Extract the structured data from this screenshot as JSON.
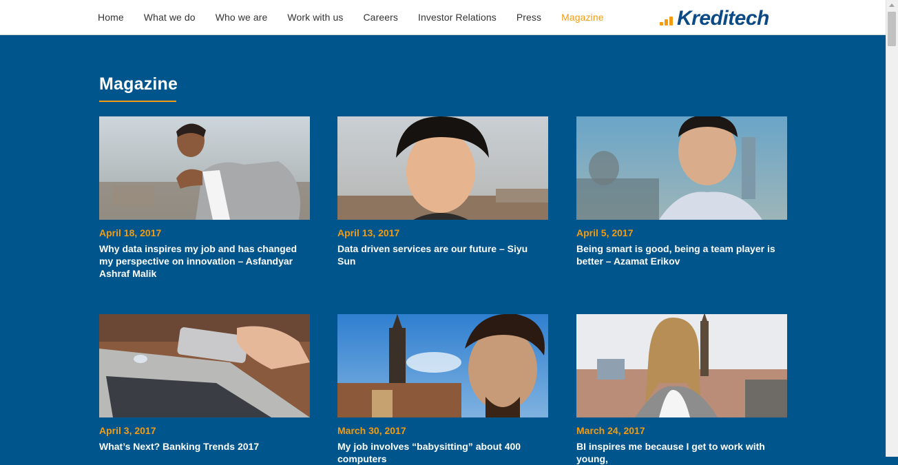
{
  "nav": {
    "items": [
      {
        "label": "Home"
      },
      {
        "label": "What we do"
      },
      {
        "label": "Who we are"
      },
      {
        "label": "Work with us"
      },
      {
        "label": "Careers"
      },
      {
        "label": "Investor Relations"
      },
      {
        "label": "Press"
      },
      {
        "label": "Magazine",
        "active": true
      }
    ],
    "logo_text": "Kreditech"
  },
  "main": {
    "title": "Magazine",
    "articles": [
      {
        "date": "April 18, 2017",
        "title": "Why data inspires my job and has changed my perspective on innovation – Asfandyar Ashraf Malik"
      },
      {
        "date": "April 13, 2017",
        "title": "Data driven services are our future – Siyu Sun"
      },
      {
        "date": "April 5, 2017",
        "title": "Being smart is good, being a team player is better – Azamat Erikov"
      },
      {
        "date": "April 3, 2017",
        "title": "What’s Next? Banking Trends 2017"
      },
      {
        "date": "March 30, 2017",
        "title": "My job involves “babysitting” about 400 computers"
      },
      {
        "date": "March 24, 2017",
        "title": "BI inspires me because I get to work with young,"
      }
    ]
  },
  "colors": {
    "background": "#00558c",
    "accent": "#f39c12",
    "logo": "#0b4a85"
  }
}
